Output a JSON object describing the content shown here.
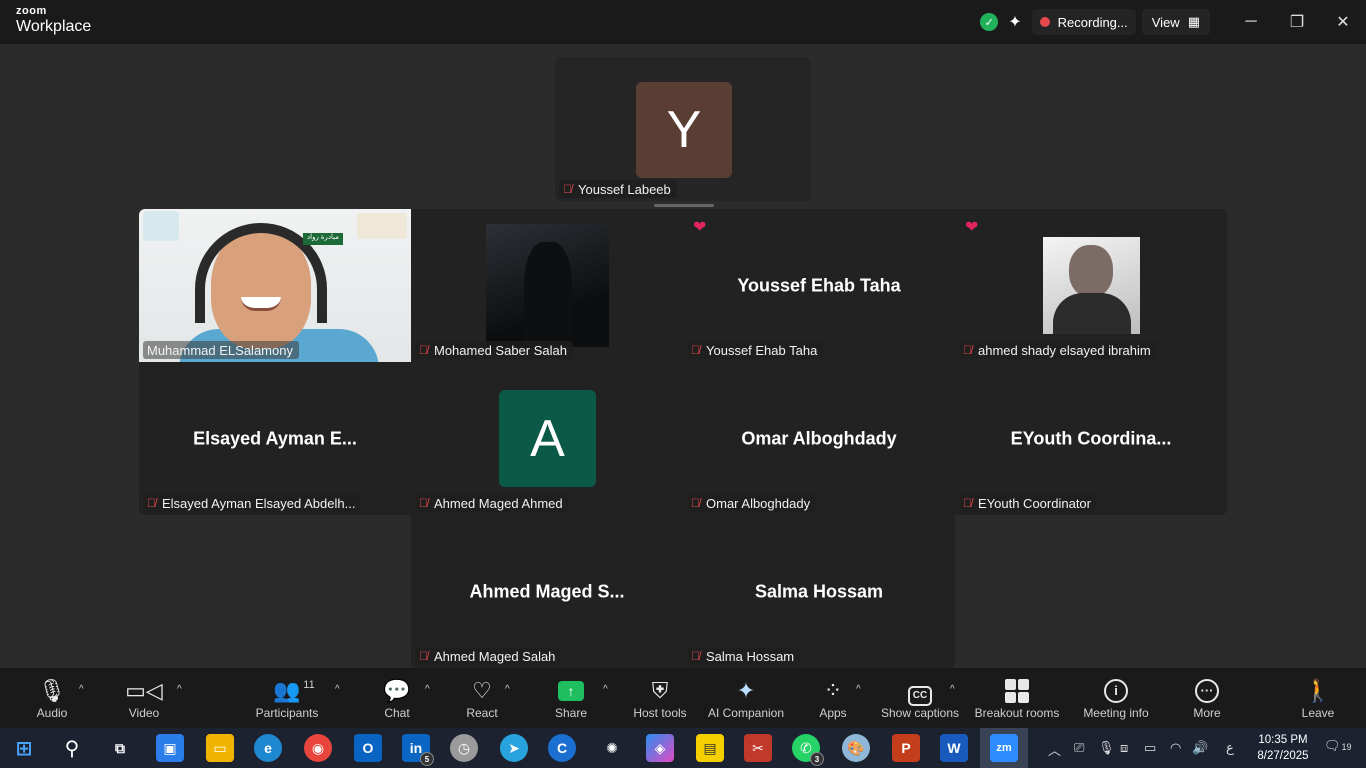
{
  "titlebar": {
    "brand_top": "zoom",
    "brand_bottom": "Workplace",
    "recording_label": "Recording...",
    "view_label": "View"
  },
  "participants": [
    {
      "name": "Youssef Labeeb",
      "avatar_letter": "Y",
      "avatar_color": "#5a3d33"
    },
    {
      "name": "Muhammad ELSalamony",
      "video": true
    },
    {
      "name": "Mohamed Saber Salah"
    },
    {
      "name": "Youssef Ehab Taha",
      "display_name": "Youssef Ehab Taha",
      "reaction": "heart"
    },
    {
      "name": "ahmed shady elsayed ibrahim",
      "reaction": "heart"
    },
    {
      "name": "Elsayed Ayman Elsayed Abdelh...",
      "display_name": "Elsayed Ayman E..."
    },
    {
      "name": "Ahmed Maged Ahmed",
      "avatar_letter": "A",
      "avatar_color": "#0b5947"
    },
    {
      "name": "Omar Alboghdady",
      "display_name": "Omar Alboghdady"
    },
    {
      "name": "EYouth Coordinator",
      "display_name": "EYouth  Coordina..."
    },
    {
      "name": "Ahmed Maged Salah",
      "display_name": "Ahmed  Maged  S..."
    },
    {
      "name": "Salma Hossam",
      "display_name": "Salma Hossam"
    }
  ],
  "camera_overlay": {
    "banner_text": "مبادرة رواد"
  },
  "toolbar": {
    "audio": "Audio",
    "video": "Video",
    "participants": "Participants",
    "participants_count": "11",
    "chat": "Chat",
    "react": "React",
    "share": "Share",
    "host_tools": "Host tools",
    "ai_companion": "AI Companion",
    "apps": "Apps",
    "show_captions": "Show captions",
    "breakout_rooms": "Breakout rooms",
    "meeting_info": "Meeting info",
    "more": "More",
    "leave": "Leave",
    "cc_icon_text": "CC"
  },
  "taskbar": {
    "linkedin_badge": "5",
    "whatsapp_badge": "3",
    "zoom_label": "zm",
    "linkedin_label": "in",
    "powerpoint_label": "P",
    "word_label": "W",
    "keyboard_lang": "ع",
    "time": "10:35 PM",
    "date": "8/27/2025",
    "notifications": "19"
  },
  "colors": {
    "background": "#2b2b2b",
    "tile": "#222222",
    "share_green": "#1fbf5f",
    "mic_muted": "#e5484d",
    "reaction_heart": "#e0245e"
  }
}
